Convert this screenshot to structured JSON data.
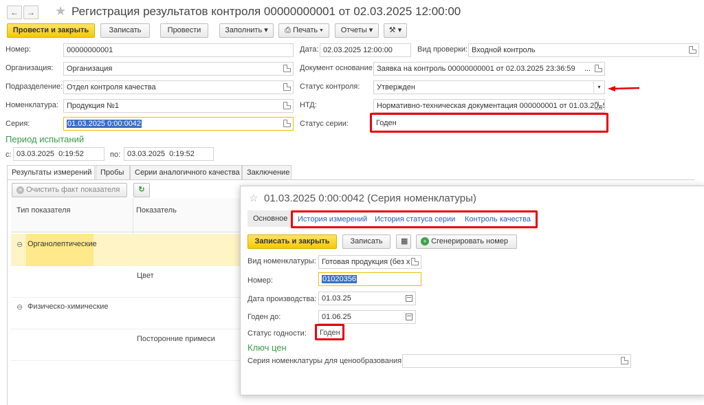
{
  "window": {
    "title": "Регистрация результатов контроля 00000000001 от 02.03.2025 12:00:00"
  },
  "toolbar": {
    "post_close": "Провести и закрыть",
    "save": "Записать",
    "post": "Провести",
    "fill": "Заполнить",
    "print": "Печать",
    "reports": "Отчеты"
  },
  "form": {
    "number_label": "Номер:",
    "number_value": "00000000001",
    "date_label": "Дата:",
    "date_value": "02.03.2025 12:00:00",
    "check_type_label": "Вид проверки:",
    "check_type_value": "Входной контроль",
    "org_label": "Организация:",
    "org_value": "Организация",
    "base_doc_label": "Документ основание:",
    "base_doc_value": "Заявка на контроль 00000000001 от 02.03.2025 23:36:59",
    "dept_label": "Подразделение:",
    "dept_value": "Отдел контроля качества",
    "control_status_label": "Статус контроля:",
    "control_status_value": "Утвержден",
    "nomenclature_label": "Номенклатура:",
    "nomenclature_value": "Продукция №1",
    "ntd_label": "НТД:",
    "ntd_value": "Нормативно-техническая документация 000000001 от 01.03.2025",
    "series_label": "Серия:",
    "series_value": "01.03.2025 0:00:0042",
    "series_status_label": "Статус серии:",
    "series_status_value": "Годен"
  },
  "period": {
    "title": "Период испытаний",
    "from_label": "с:",
    "from_value": "03.03.2025  0:19:52",
    "to_label": "по:",
    "to_value": "03.03.2025  0:19:52"
  },
  "tabs": [
    {
      "label": "Результаты измерений"
    },
    {
      "label": "Пробы"
    },
    {
      "label": "Серии аналогичного качества"
    },
    {
      "label": "Заключение"
    }
  ],
  "results": {
    "clear_btn": "Очистить факт показателя",
    "col_type": "Тип показателя",
    "col_indicator": "Показатель",
    "rows": [
      {
        "type": "Органолептические",
        "indicator": ""
      },
      {
        "type": "",
        "indicator": "Цвет"
      },
      {
        "type": "Физическо-химические",
        "indicator": ""
      },
      {
        "type": "",
        "indicator": "Посторонние примеси"
      }
    ]
  },
  "popup": {
    "title": "01.03.2025 0:00:0042 (Серия номенклатуры)",
    "tab_main": "Основное",
    "links": [
      "История измерений",
      "История статуса серии",
      "Контроль качества"
    ],
    "save_close": "Записать и закрыть",
    "save": "Записать",
    "generate": "Сгенерировать номер",
    "kind_label": "Вид номенклатуры:",
    "kind_value": "Готовая продукция (без х",
    "number_label": "Номер:",
    "number_value": "01020356",
    "prod_date_label": "Дата производства:",
    "prod_date_value": "01.03.25",
    "valid_label": "Годен до:",
    "valid_value": "01.06.25",
    "status_label": "Статус годности:",
    "status_value": "Годен",
    "price_key_title": "Ключ цен",
    "price_series_label": "Серия номенклатуры для ценообразования:",
    "price_series_value": ""
  },
  "colors": {
    "highlight": "#e8000c",
    "accent_yellow": "#f5c900",
    "section_green": "#3a9a4a"
  }
}
